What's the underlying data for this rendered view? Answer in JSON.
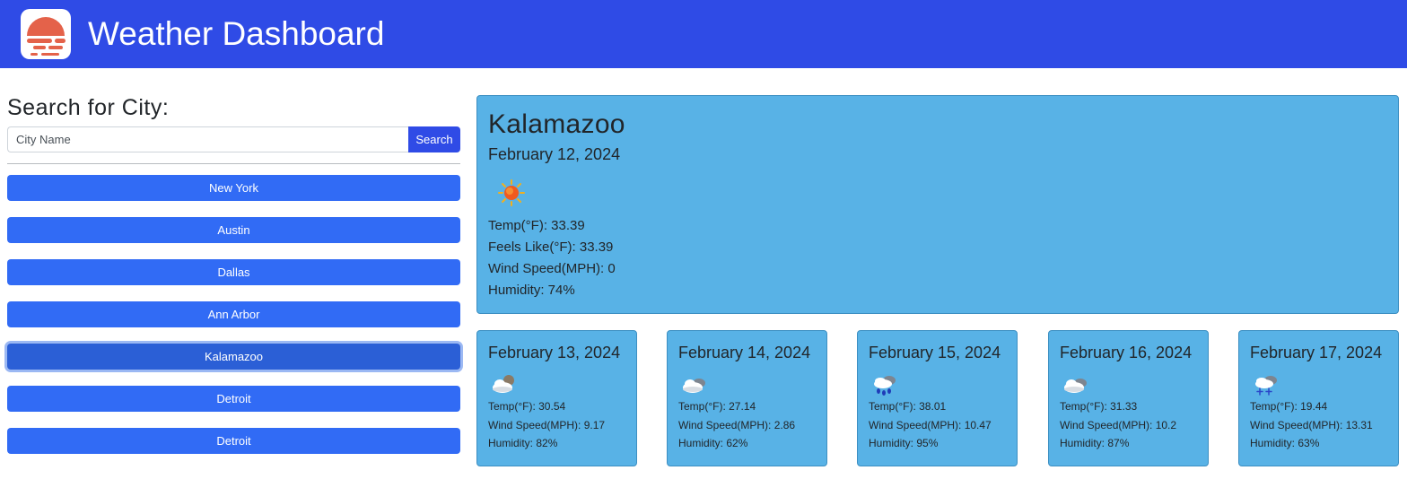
{
  "header": {
    "title": "Weather Dashboard",
    "logo_icon": "sunset-icon",
    "logo_color": "#e4624a",
    "bar_color": "#2f4be6"
  },
  "sidebar": {
    "heading": "Search for City:",
    "search": {
      "placeholder": "City Name",
      "value": "",
      "button_label": "Search"
    },
    "history": [
      {
        "label": "New York",
        "active": false
      },
      {
        "label": "Austin",
        "active": false
      },
      {
        "label": "Dallas",
        "active": false
      },
      {
        "label": "Ann Arbor",
        "active": false
      },
      {
        "label": "Kalamazoo",
        "active": true
      },
      {
        "label": "Detroit",
        "active": false
      },
      {
        "label": "Detroit",
        "active": false
      }
    ]
  },
  "current": {
    "city": "Kalamazoo",
    "date": "February 12, 2024",
    "icon": "sun-icon",
    "temp": "Temp(°F): 33.39",
    "feels_like": "Feels Like(°F): 33.39",
    "wind": "Wind Speed(MPH): 0",
    "humidity": "Humidity: 74%"
  },
  "forecast": [
    {
      "date": "February 13, 2024",
      "icon": "sun-behind-cloud-icon",
      "temp": "Temp(°F): 30.54",
      "wind": "Wind Speed(MPH): 9.17",
      "humidity": "Humidity: 82%"
    },
    {
      "date": "February 14, 2024",
      "icon": "cloud-icon",
      "temp": "Temp(°F): 27.14",
      "wind": "Wind Speed(MPH): 2.86",
      "humidity": "Humidity: 62%"
    },
    {
      "date": "February 15, 2024",
      "icon": "rain-cloud-icon",
      "temp": "Temp(°F): 38.01",
      "wind": "Wind Speed(MPH): 10.47",
      "humidity": "Humidity: 95%"
    },
    {
      "date": "February 16, 2024",
      "icon": "cloud-icon",
      "temp": "Temp(°F): 31.33",
      "wind": "Wind Speed(MPH): 10.2",
      "humidity": "Humidity: 87%"
    },
    {
      "date": "February 17, 2024",
      "icon": "snow-cloud-icon",
      "temp": "Temp(°F): 19.44",
      "wind": "Wind Speed(MPH): 13.31",
      "humidity": "Humidity: 63%"
    }
  ],
  "colors": {
    "accent": "#2f4be6",
    "city_button": "#316bf5",
    "card": "#58b2e6"
  }
}
